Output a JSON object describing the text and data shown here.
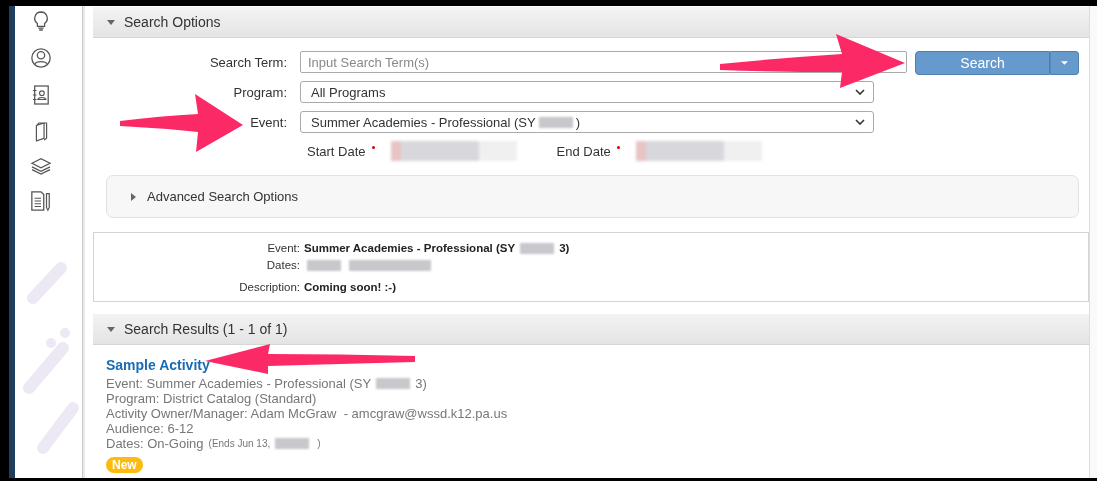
{
  "search_options": {
    "title": "Search Options",
    "expanded": true,
    "fields": [
      {
        "label": "Search Term:",
        "kind": "text",
        "placeholder": "Input Search Term(s)"
      },
      {
        "label": "Program:",
        "kind": "select",
        "value": [
          {
            "kind": "text",
            "text": "All Programs"
          }
        ]
      },
      {
        "label": "Event:",
        "kind": "select",
        "value": [
          {
            "kind": "text",
            "text": "Summer Academies - Professional (SY"
          },
          {
            "kind": "redacted"
          },
          {
            "kind": "text",
            "text": ")"
          }
        ]
      }
    ],
    "dates": [
      {
        "label": "Start Date",
        "required": true
      },
      {
        "label": "End Date",
        "required": true
      }
    ],
    "search_button": {
      "label": "Search"
    },
    "advanced": {
      "title": "Advanced Search Options",
      "expanded": false
    }
  },
  "event_info": {
    "rows": [
      {
        "label": "Event:",
        "value": [
          {
            "kind": "text",
            "text": "Summer Academies - Professional (SY"
          },
          {
            "kind": "redacted"
          },
          {
            "kind": "text",
            "text": "3)"
          }
        ]
      },
      {
        "label": "Dates:",
        "value": [
          {
            "kind": "redacted"
          },
          {
            "kind": "redacted"
          }
        ]
      },
      {
        "label": "Description:",
        "value": [
          {
            "kind": "text",
            "text": "Coming soon! :-)"
          }
        ]
      }
    ]
  },
  "search_results": {
    "title": "Search Results (1 - 1 of 1)",
    "expanded": true,
    "results": [
      {
        "title": "Sample Activity",
        "badge": "New",
        "lines": [
          [
            {
              "kind": "text",
              "text": "Event: Summer Academies - Professional (SY"
            },
            {
              "kind": "redacted"
            },
            {
              "kind": "text",
              "text": "3)"
            }
          ],
          [
            {
              "kind": "text",
              "text": "Program: District Catalog (Standard)"
            }
          ],
          [
            {
              "kind": "text",
              "text": "Activity Owner/Manager: Adam McGraw  - amcgraw@wssd.k12.pa.us"
            }
          ],
          [
            {
              "kind": "text",
              "text": "Audience: 6-12"
            }
          ],
          [
            {
              "kind": "text",
              "text": "Dates: On-Going"
            },
            {
              "kind": "small",
              "text": "(Ends Jun 13,"
            },
            {
              "kind": "redacted"
            },
            {
              "kind": "small",
              "text": ")"
            }
          ]
        ]
      }
    ]
  }
}
